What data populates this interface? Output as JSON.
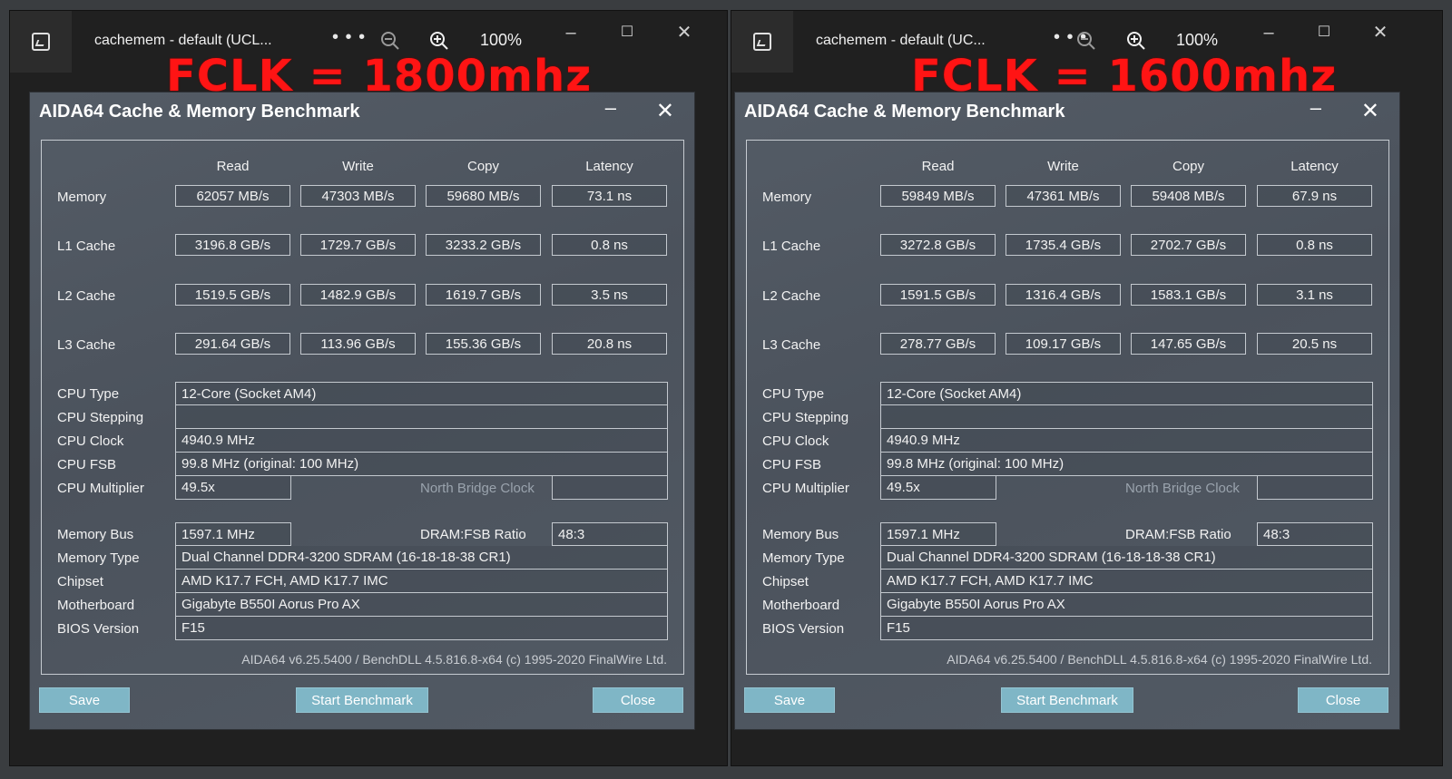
{
  "windows": [
    {
      "viewer_title": "cachemem - default (UCL...",
      "more_label": "• • •",
      "zoom": "100%",
      "annotation": "FCLK = 1800mhz",
      "annotation_color": "#ff1414",
      "dialog_title": "AIDA64 Cache & Memory Benchmark",
      "headers": [
        "Read",
        "Write",
        "Copy",
        "Latency"
      ],
      "rows": [
        {
          "label": "Memory",
          "values": [
            "62057 MB/s",
            "47303 MB/s",
            "59680 MB/s",
            "73.1 ns"
          ]
        },
        {
          "label": "L1 Cache",
          "values": [
            "3196.8 GB/s",
            "1729.7 GB/s",
            "3233.2 GB/s",
            "0.8 ns"
          ]
        },
        {
          "label": "L2 Cache",
          "values": [
            "1519.5 GB/s",
            "1482.9 GB/s",
            "1619.7 GB/s",
            "3.5 ns"
          ]
        },
        {
          "label": "L3 Cache",
          "values": [
            "291.64 GB/s",
            "113.96 GB/s",
            "155.36 GB/s",
            "20.8 ns"
          ]
        }
      ],
      "cpu_type_label": "CPU Type",
      "cpu_type": "12-Core   (Socket AM4)",
      "cpu_stepping_label": "CPU Stepping",
      "cpu_stepping": "",
      "cpu_clock_label": "CPU Clock",
      "cpu_clock": "4940.9 MHz",
      "cpu_fsb_label": "CPU FSB",
      "cpu_fsb": "99.8 MHz  (original: 100 MHz)",
      "cpu_multiplier_label": "CPU Multiplier",
      "cpu_multiplier": "49.5x",
      "north_bridge_label": "North Bridge Clock",
      "north_bridge": "",
      "memory_bus_label": "Memory Bus",
      "memory_bus": "1597.1 MHz",
      "dram_fsb_label": "DRAM:FSB Ratio",
      "dram_fsb": "48:3",
      "memory_type_label": "Memory Type",
      "memory_type": "Dual Channel DDR4-3200 SDRAM  (16-18-18-38 CR1)",
      "chipset_label": "Chipset",
      "chipset": "AMD K17.7 FCH, AMD K17.7 IMC",
      "motherboard_label": "Motherboard",
      "motherboard": "Gigabyte B550I Aorus Pro AX",
      "bios_label": "BIOS Version",
      "bios": "F15",
      "footer": "AIDA64 v6.25.5400 / BenchDLL 4.5.816.8-x64  (c) 1995-2020 FinalWire Ltd.",
      "save_label": "Save",
      "start_label": "Start Benchmark",
      "close_label": "Close"
    },
    {
      "viewer_title": "cachemem - default (UC...",
      "more_label": "• • •",
      "zoom": "100%",
      "annotation": "FCLK = 1600mhz",
      "annotation_color": "#ff1414",
      "dialog_title": "AIDA64 Cache & Memory Benchmark",
      "headers": [
        "Read",
        "Write",
        "Copy",
        "Latency"
      ],
      "rows": [
        {
          "label": "Memory",
          "values": [
            "59849 MB/s",
            "47361 MB/s",
            "59408 MB/s",
            "67.9 ns"
          ]
        },
        {
          "label": "L1 Cache",
          "values": [
            "3272.8 GB/s",
            "1735.4 GB/s",
            "2702.7 GB/s",
            "0.8 ns"
          ]
        },
        {
          "label": "L2 Cache",
          "values": [
            "1591.5 GB/s",
            "1316.4 GB/s",
            "1583.1 GB/s",
            "3.1 ns"
          ]
        },
        {
          "label": "L3 Cache",
          "values": [
            "278.77 GB/s",
            "109.17 GB/s",
            "147.65 GB/s",
            "20.5 ns"
          ]
        }
      ],
      "cpu_type_label": "CPU Type",
      "cpu_type": "12-Core   (Socket AM4)",
      "cpu_stepping_label": "CPU Stepping",
      "cpu_stepping": "",
      "cpu_clock_label": "CPU Clock",
      "cpu_clock": "4940.9 MHz",
      "cpu_fsb_label": "CPU FSB",
      "cpu_fsb": "99.8 MHz  (original: 100 MHz)",
      "cpu_multiplier_label": "CPU Multiplier",
      "cpu_multiplier": "49.5x",
      "north_bridge_label": "North Bridge Clock",
      "north_bridge": "",
      "memory_bus_label": "Memory Bus",
      "memory_bus": "1597.1 MHz",
      "dram_fsb_label": "DRAM:FSB Ratio",
      "dram_fsb": "48:3",
      "memory_type_label": "Memory Type",
      "memory_type": "Dual Channel DDR4-3200 SDRAM  (16-18-18-38 CR1)",
      "chipset_label": "Chipset",
      "chipset": "AMD K17.7 FCH, AMD K17.7 IMC",
      "motherboard_label": "Motherboard",
      "motherboard": "Gigabyte B550I Aorus Pro AX",
      "bios_label": "BIOS Version",
      "bios": "F15",
      "footer": "AIDA64 v6.25.5400 / BenchDLL 4.5.816.8-x64  (c) 1995-2020 FinalWire Ltd.",
      "save_label": "Save",
      "start_label": "Start Benchmark",
      "close_label": "Close"
    }
  ]
}
